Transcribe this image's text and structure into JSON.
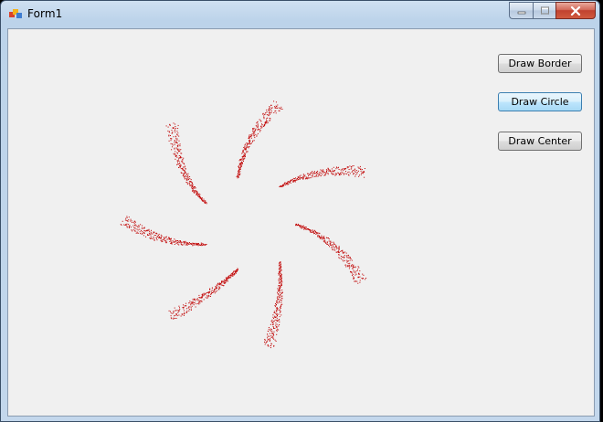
{
  "window": {
    "title": "Form1"
  },
  "buttons": {
    "draw_border": "Draw Border",
    "draw_circle": "Draw Circle",
    "draw_center": "Draw Center"
  },
  "colors": {
    "dots": "#c00000"
  },
  "icons": {
    "app": "form-app-icon",
    "minimize": "minimize-icon",
    "maximize": "maximize-icon",
    "close": "close-icon"
  }
}
